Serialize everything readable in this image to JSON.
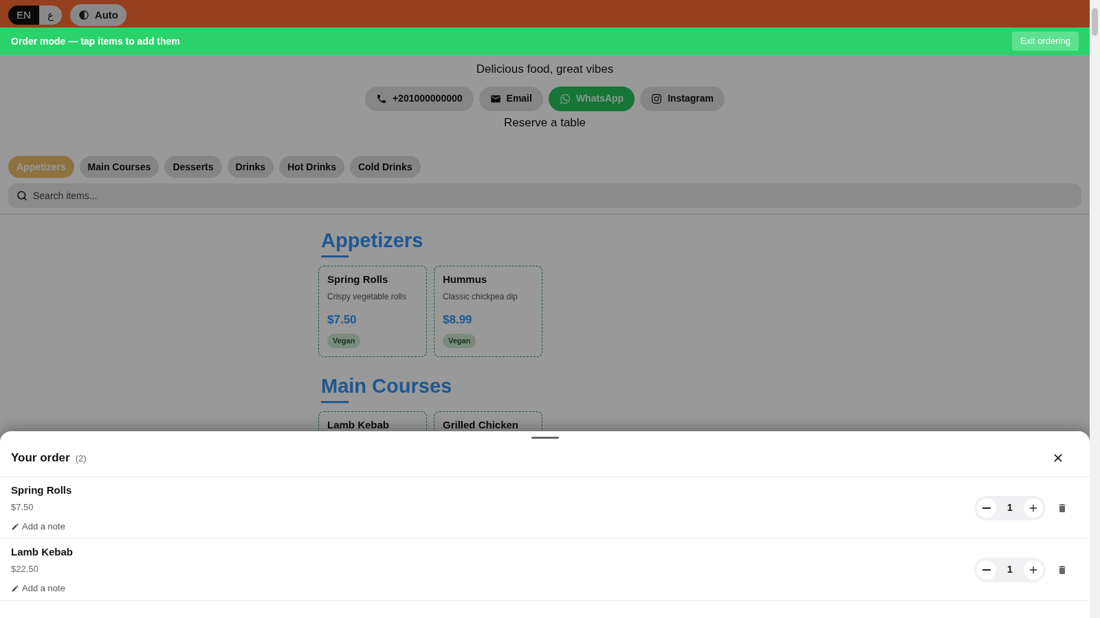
{
  "header": {
    "languages": [
      {
        "label": "EN",
        "selected": true
      },
      {
        "label": "ع",
        "selected": false
      }
    ],
    "theme_button": "Auto"
  },
  "order_banner": {
    "text": "Order mode — tap items to add them",
    "exit_button": "Exit ordering"
  },
  "tagline": "Delicious food, great vibes",
  "contacts": [
    {
      "kind": "phone",
      "label": "+201000000000"
    },
    {
      "kind": "email",
      "label": "Email"
    },
    {
      "kind": "whatsapp",
      "label": "WhatsApp"
    },
    {
      "kind": "instagram",
      "label": "Instagram"
    }
  ],
  "reserve_link": "Reserve a table",
  "categories": [
    {
      "label": "Appetizers",
      "selected": true
    },
    {
      "label": "Main Courses",
      "selected": false
    },
    {
      "label": "Desserts",
      "selected": false
    },
    {
      "label": "Drinks",
      "selected": false
    },
    {
      "label": "Hot Drinks",
      "selected": false
    },
    {
      "label": "Cold Drinks",
      "selected": false
    }
  ],
  "search": {
    "placeholder": "Search items..."
  },
  "sections": [
    {
      "title": "Appetizers",
      "items": [
        {
          "name": "Spring Rolls",
          "description": "Crispy vegetable rolls",
          "price": "$7.50",
          "tags": [
            "Vegan"
          ]
        },
        {
          "name": "Hummus",
          "description": "Classic chickpea dip",
          "price": "$8.99",
          "tags": [
            "Vegan"
          ]
        }
      ]
    },
    {
      "title": "Main Courses",
      "items": [
        {
          "name": "Lamb Kebab"
        },
        {
          "name": "Grilled Chicken"
        }
      ]
    }
  ],
  "order_sheet": {
    "title": "Your order",
    "count": "(2)",
    "items": [
      {
        "name": "Spring Rolls",
        "price": "$7.50",
        "note_link": "Add a note",
        "quantity": "1"
      },
      {
        "name": "Lamb Kebab",
        "price": "$22.50",
        "note_link": "Add a note",
        "quantity": "1"
      }
    ]
  }
}
